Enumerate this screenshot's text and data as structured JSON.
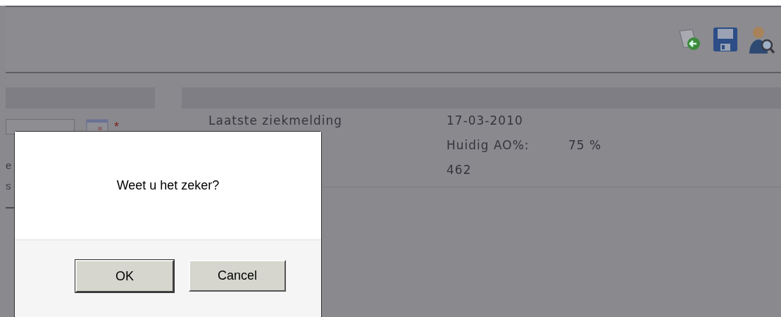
{
  "left_panel": {
    "required_mark": "*",
    "fragments": [
      "e",
      "s"
    ]
  },
  "right_panel": {
    "rows": [
      {
        "value": "17-03-2010",
        "label": "Laatste ziekmelding"
      },
      {
        "value": "Huidig AO%:",
        "extra": "75 %"
      },
      {
        "value": "462"
      }
    ]
  },
  "dialog": {
    "message": "Weet u het zeker?",
    "buttons": [
      {
        "label": "OK",
        "default": true
      },
      {
        "label": "Cancel",
        "default": false
      }
    ]
  }
}
